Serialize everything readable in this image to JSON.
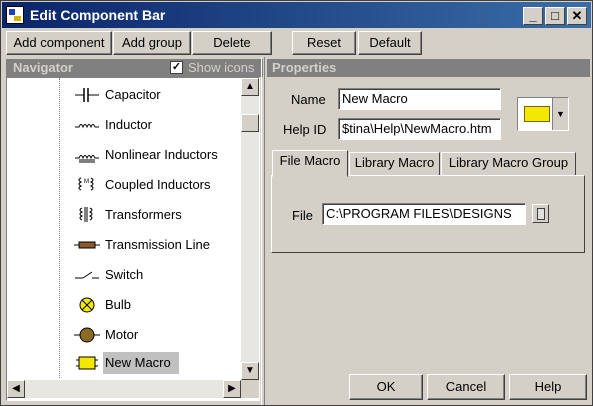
{
  "window": {
    "title": "Edit Component Bar"
  },
  "titlebar_buttons": {
    "minimize": "_",
    "maximize": "□",
    "close": "✕"
  },
  "toolbar": {
    "add_component": "Add component",
    "add_group": "Add group",
    "delete": "Delete",
    "reset": "Reset",
    "default": "Default"
  },
  "navigator": {
    "title": "Navigator",
    "show_icons_label": "Show icons",
    "show_icons_checked": true,
    "items": [
      {
        "label": "Capacitor",
        "icon": "capacitor-icon"
      },
      {
        "label": "Inductor",
        "icon": "inductor-icon"
      },
      {
        "label": "Nonlinear Inductors",
        "icon": "nonlinear-inductor-icon"
      },
      {
        "label": "Coupled Inductors",
        "icon": "coupled-inductors-icon"
      },
      {
        "label": "Transformers",
        "icon": "transformer-icon"
      },
      {
        "label": "Transmission Line",
        "icon": "transmission-line-icon"
      },
      {
        "label": "Switch",
        "icon": "switch-icon"
      },
      {
        "label": "Bulb",
        "icon": "bulb-icon"
      },
      {
        "label": "Motor",
        "icon": "motor-icon"
      },
      {
        "label": "New Macro",
        "icon": "macro-chip-icon",
        "selected": true
      }
    ]
  },
  "properties": {
    "title": "Properties",
    "name_label": "Name",
    "name_value": "New Macro",
    "helpid_label": "Help ID",
    "helpid_value": "$tina\\Help\\NewMacro.htm",
    "tabs": [
      "File Macro",
      "Library Macro",
      "Library Macro Group"
    ],
    "active_tab": "File Macro",
    "file_label": "File",
    "file_value": "C:\\PROGRAM FILES\\DESIGNS"
  },
  "footer": {
    "ok": "OK",
    "cancel": "Cancel",
    "help": "Help"
  },
  "colors": {
    "titlebar": "#0a246a",
    "chip": "#f2e800",
    "face": "#d4d0c8"
  }
}
